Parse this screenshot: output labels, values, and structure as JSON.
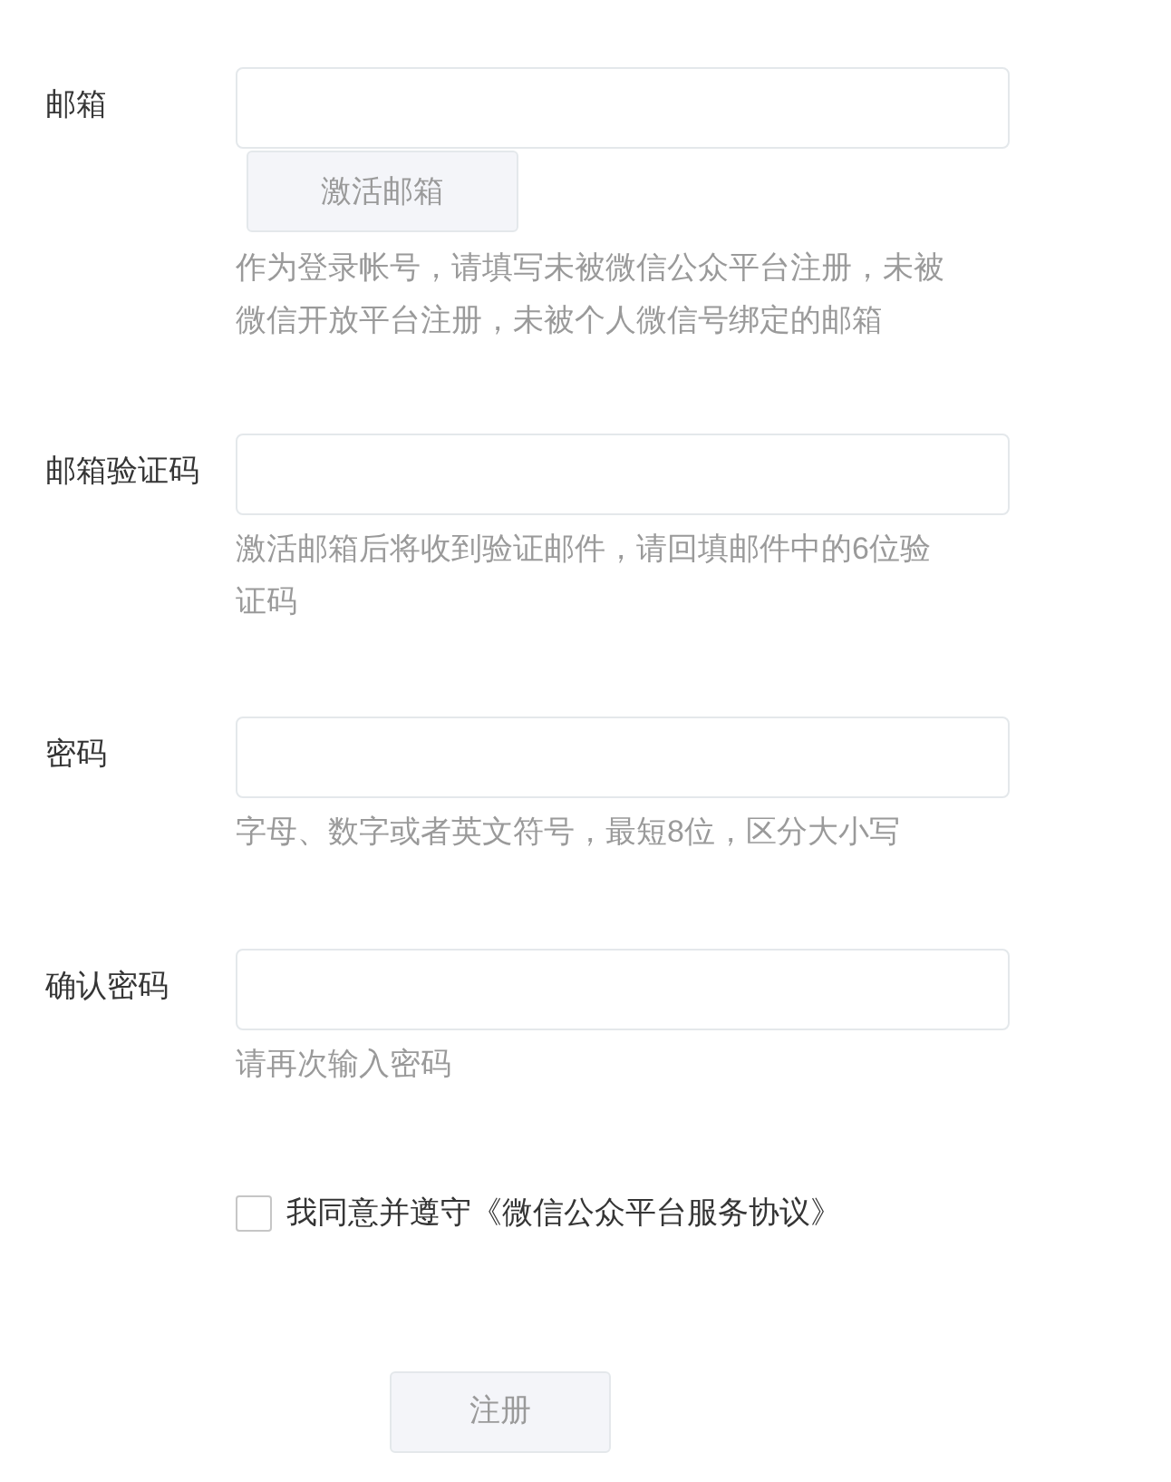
{
  "fields": [
    {
      "label": "邮箱",
      "button": {
        "label": "激活邮箱",
        "disabled": true
      },
      "hint": "作为登录帐号，请填写未被微信公众平台注册，未被微信开放平台注册，未被个人微信号绑定的邮箱"
    },
    {
      "label": "邮箱验证码",
      "hint": "激活邮箱后将收到验证邮件，请回填邮件中的6位验证码"
    },
    {
      "label": "密码",
      "hint": "字母、数字或者英文符号，最短8位，区分大小写"
    },
    {
      "label": "确认密码",
      "hint": "请再次输入密码"
    }
  ],
  "agreement": {
    "checked": false,
    "text": "我同意并遵守",
    "link": "《微信公众平台服务协议》"
  },
  "submit": {
    "label": "注册",
    "disabled": true
  }
}
